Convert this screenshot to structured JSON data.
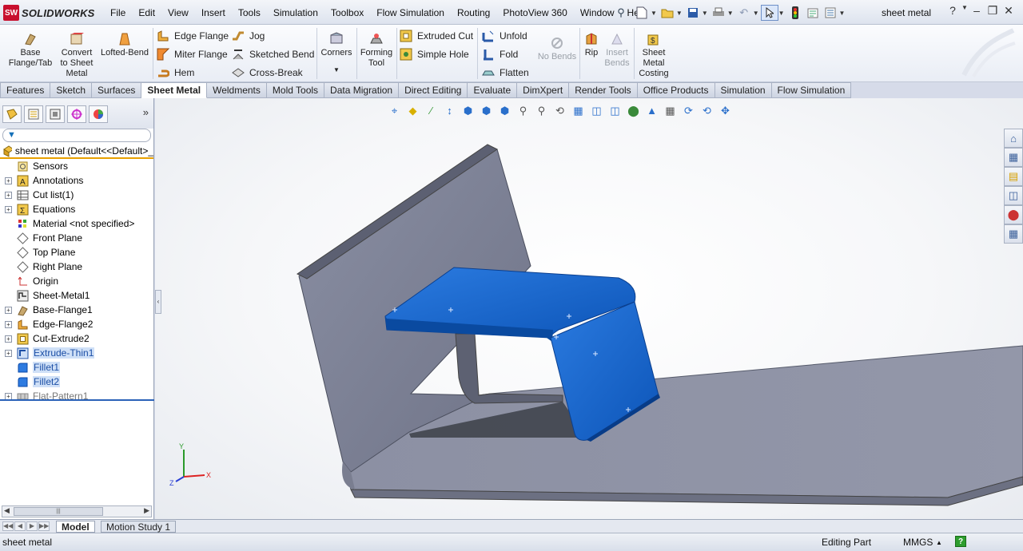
{
  "app": {
    "logo_text": "SOLIDWORKS",
    "logo_badge": "SW"
  },
  "menu": [
    "File",
    "Edit",
    "View",
    "Insert",
    "Tools",
    "Simulation",
    "Toolbox",
    "Flow Simulation",
    "Routing",
    "PhotoView 360",
    "Window",
    "Help"
  ],
  "document_title": "sheet metal",
  "command_manager": {
    "big": [
      {
        "label": "Base\nFlange/Tab",
        "icon": "base-flange-icon"
      },
      {
        "label": "Convert\nto Sheet\nMetal",
        "icon": "convert-sheet-metal-icon"
      },
      {
        "label": "Lofted-Bend",
        "icon": "lofted-bend-icon"
      },
      {
        "label": "Corners",
        "icon": "corners-icon"
      },
      {
        "label": "Forming\nTool",
        "icon": "forming-tool-icon"
      },
      {
        "label": "No Bends",
        "icon": "no-bends-icon"
      },
      {
        "label": "Rip",
        "icon": "rip-icon"
      },
      {
        "label": "Insert\nBends",
        "icon": "insert-bends-icon"
      },
      {
        "label": "Sheet\nMetal\nCosting",
        "icon": "sheet-metal-costing-icon"
      }
    ],
    "small": [
      {
        "label": "Edge Flange",
        "icon": "edge-flange-icon"
      },
      {
        "label": "Miter Flange",
        "icon": "miter-flange-icon"
      },
      {
        "label": "Hem",
        "icon": "hem-icon"
      },
      {
        "label": "Jog",
        "icon": "jog-icon"
      },
      {
        "label": "Sketched Bend",
        "icon": "sketched-bend-icon"
      },
      {
        "label": "Cross-Break",
        "icon": "cross-break-icon"
      },
      {
        "label": "Extruded Cut",
        "icon": "extruded-cut-icon"
      },
      {
        "label": "Simple Hole",
        "icon": "simple-hole-icon"
      },
      {
        "label": "Unfold",
        "icon": "unfold-icon"
      },
      {
        "label": "Fold",
        "icon": "fold-icon"
      },
      {
        "label": "Flatten",
        "icon": "flatten-icon"
      }
    ]
  },
  "tabs": [
    "Features",
    "Sketch",
    "Surfaces",
    "Sheet Metal",
    "Weldments",
    "Mold Tools",
    "Data Migration",
    "Direct Editing",
    "Evaluate",
    "DimXpert",
    "Render Tools",
    "Office Products",
    "Simulation",
    "Flow Simulation"
  ],
  "active_tab": "Sheet Metal",
  "feature_tree": {
    "root": "sheet metal  (Default<<Default>_",
    "items": [
      {
        "label": "Sensors",
        "icon": "sensors-icon",
        "expandable": false
      },
      {
        "label": "Annotations",
        "icon": "annotations-icon",
        "expandable": true
      },
      {
        "label": "Cut list(1)",
        "icon": "cut-list-icon",
        "expandable": true
      },
      {
        "label": "Equations",
        "icon": "equations-icon",
        "expandable": true
      },
      {
        "label": "Material <not specified>",
        "icon": "material-icon",
        "expandable": false
      },
      {
        "label": "Front Plane",
        "icon": "plane-icon",
        "expandable": false
      },
      {
        "label": "Top Plane",
        "icon": "plane-icon",
        "expandable": false
      },
      {
        "label": "Right Plane",
        "icon": "plane-icon",
        "expandable": false
      },
      {
        "label": "Origin",
        "icon": "origin-icon",
        "expandable": false
      },
      {
        "label": "Sheet-Metal1",
        "icon": "sheet-metal-feature-icon",
        "expandable": false
      },
      {
        "label": "Base-Flange1",
        "icon": "base-flange-feature-icon",
        "expandable": true
      },
      {
        "label": "Edge-Flange2",
        "icon": "edge-flange-feature-icon",
        "expandable": true
      },
      {
        "label": "Cut-Extrude2",
        "icon": "cut-extrude-icon",
        "expandable": true
      },
      {
        "label": "Extrude-Thin1",
        "icon": "extrude-thin-icon",
        "expandable": true,
        "selected": true
      },
      {
        "label": "Fillet1",
        "icon": "fillet-icon",
        "expandable": false,
        "selected": true
      },
      {
        "label": "Fillet2",
        "icon": "fillet-icon",
        "expandable": false,
        "selected": true
      },
      {
        "label": "Flat-Pattern1",
        "icon": "flat-pattern-icon",
        "expandable": true,
        "suppressed": true
      }
    ]
  },
  "bottom_tabs": {
    "model": "Model",
    "motion": "Motion Study 1"
  },
  "status": {
    "left": "sheet metal",
    "mode": "Editing Part",
    "units": "MMGS",
    "units_arrow": "▲",
    "help_mark": "?"
  },
  "triad": {
    "x": "X",
    "y": "Y",
    "z": "Z"
  },
  "colors": {
    "accent": "#1f66c4",
    "part_grey": "#8c8fa0",
    "selected_blue": "#1565c8"
  }
}
